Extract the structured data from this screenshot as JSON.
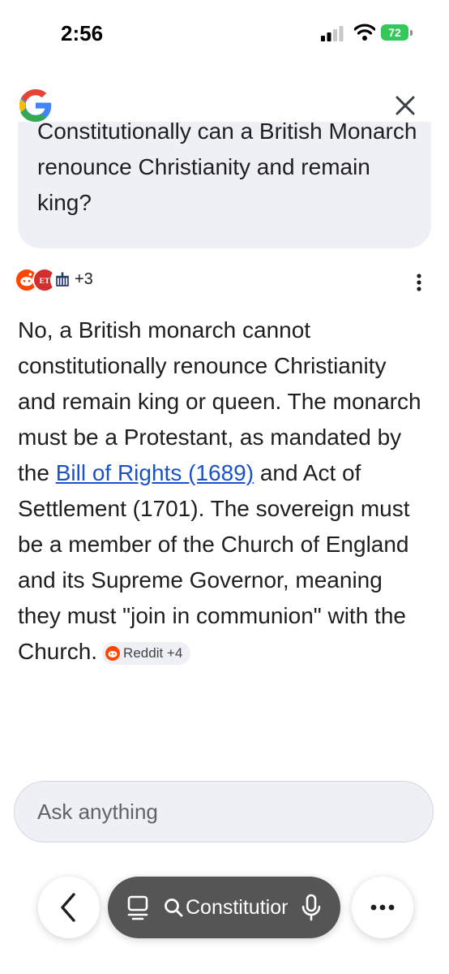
{
  "status_bar": {
    "time": "2:56",
    "battery": "72"
  },
  "query": {
    "text": "Constitutionally can a British Monarch renounce Christianity and remain king?"
  },
  "sources": {
    "more_count": "+3",
    "icons": [
      "reddit-icon",
      "et-icon",
      "parliament-icon"
    ]
  },
  "answer": {
    "part1": "No, a British monarch cannot constitutionally renounce Christianity and remain king or queen. The monarch must be a Protestant, as mandated by the ",
    "link": "Bill of Rights (1689)",
    "part2": " and Act of Settlement (1701). The sovereign must be a member of the Church of England and its Supreme Governor, meaning they must \"join in communion\" with the Church.",
    "chip_label": "Reddit +4"
  },
  "ask": {
    "placeholder": "Ask anything"
  },
  "bottom_bar": {
    "search_text": "Constitutionally can a British Monarch renounce Christianity and remain king?"
  },
  "colors": {
    "link": "#1a53c9",
    "bubble": "#eef0f5",
    "reddit": "#ff4500",
    "battery": "#34c759",
    "pill": "#555555"
  }
}
